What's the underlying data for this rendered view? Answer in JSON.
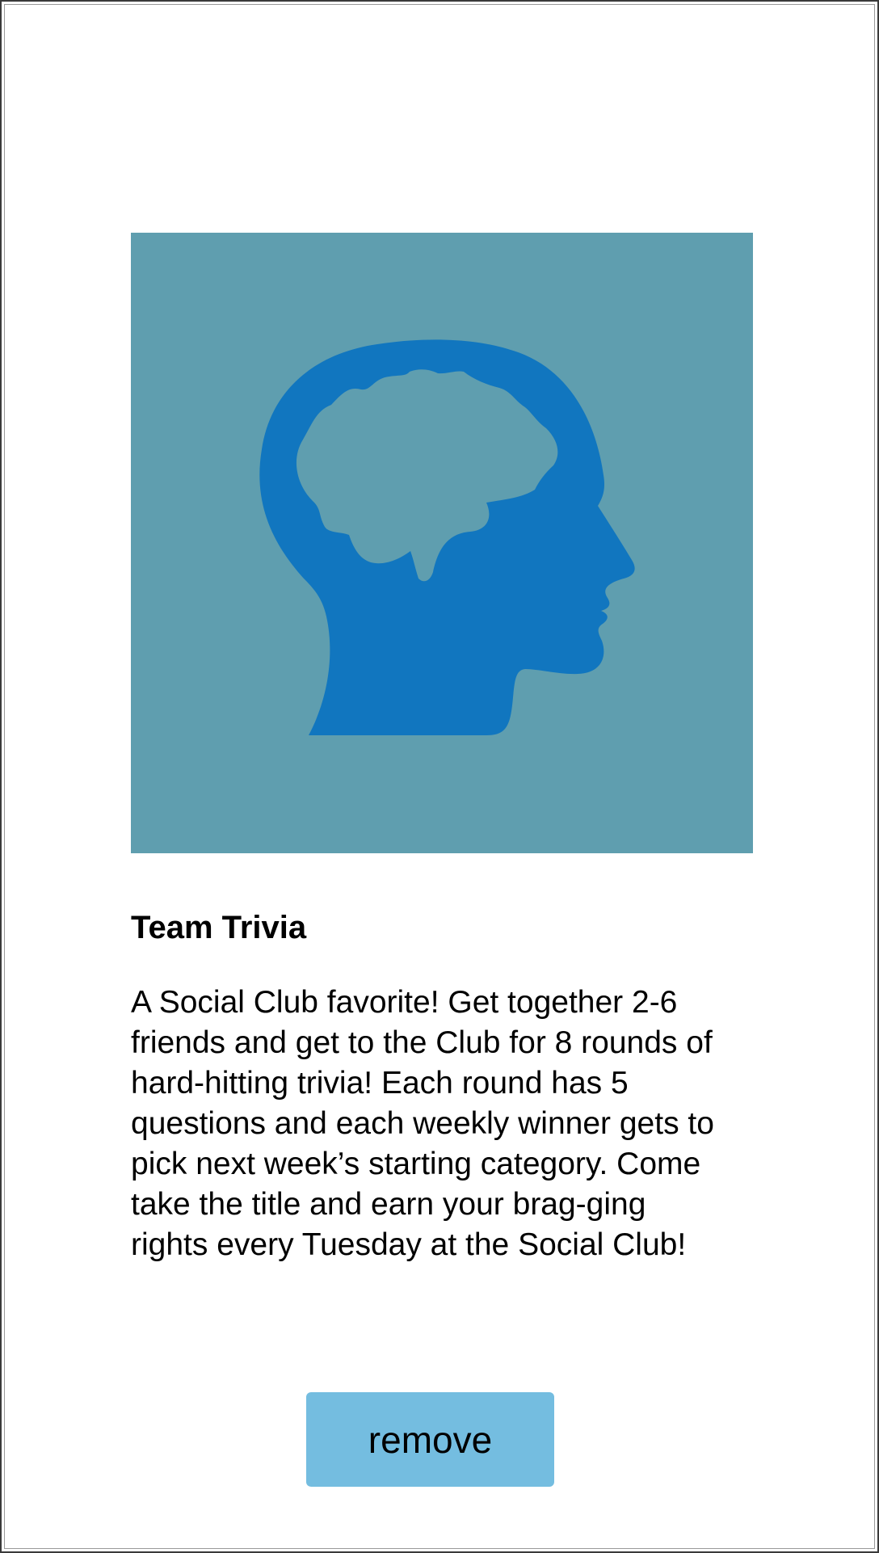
{
  "event": {
    "image_icon": "head-brain-icon",
    "title": "Team Trivia",
    "description": "A Social Club favorite! Get together 2-6 friends and get to the Club for 8 rounds of hard-hitting trivia! Each round has 5 questions and each weekly winner gets to pick next week’s starting category. Come take the title and earn your brag-ging rights every Tuesday at the Social Club!"
  },
  "actions": {
    "remove_label": "remove"
  },
  "colors": {
    "image_background": "#5f9eaf",
    "icon": "#1176bf",
    "button": "#74bde0"
  }
}
